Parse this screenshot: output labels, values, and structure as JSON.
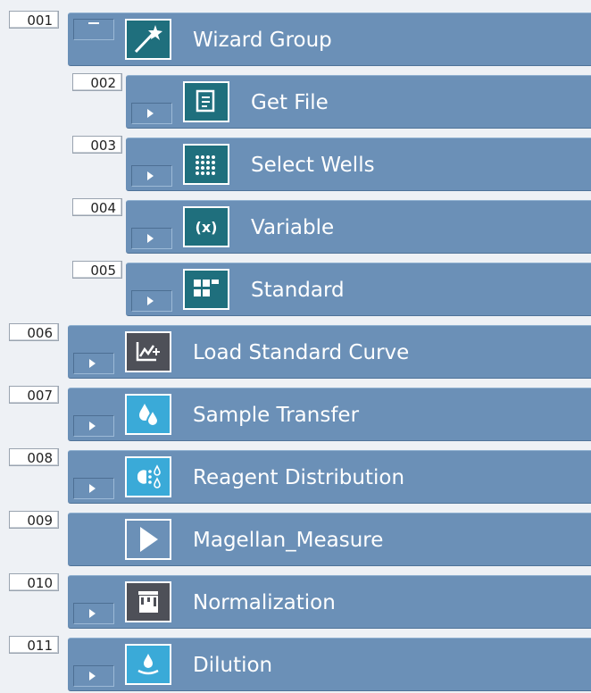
{
  "steps": [
    {
      "number": "001",
      "label": "Wizard Group",
      "icon": "wand-icon",
      "toggle": "collapse"
    },
    {
      "number": "002",
      "label": "Get File",
      "icon": "file-icon",
      "toggle": "expand"
    },
    {
      "number": "003",
      "label": "Select Wells",
      "icon": "wells-grid-icon",
      "toggle": "expand"
    },
    {
      "number": "004",
      "label": "Variable",
      "icon": "variable-icon",
      "icon_text": "(x)",
      "toggle": "expand"
    },
    {
      "number": "005",
      "label": "Standard",
      "icon": "standard-grid-icon",
      "toggle": "expand"
    },
    {
      "number": "006",
      "label": "Load Standard Curve",
      "icon": "curve-icon",
      "toggle": "expand"
    },
    {
      "number": "007",
      "label": "Sample Transfer",
      "icon": "droplets-icon",
      "toggle": "expand"
    },
    {
      "number": "008",
      "label": "Reagent Distribution",
      "icon": "reagent-icon",
      "toggle": "expand"
    },
    {
      "number": "009",
      "label": "Magellan_Measure",
      "icon": "play-icon",
      "toggle": "none"
    },
    {
      "number": "010",
      "label": "Normalization",
      "icon": "normalization-icon",
      "toggle": "expand"
    },
    {
      "number": "011",
      "label": "Dilution",
      "icon": "dilution-icon",
      "toggle": "expand"
    }
  ],
  "colors": {
    "bar": "#6b90b7",
    "teal_icon": "#1f6f7d",
    "light_blue_icon": "#3aaad8",
    "dark_icon": "#4e5058",
    "number_box": "#ffffff"
  }
}
